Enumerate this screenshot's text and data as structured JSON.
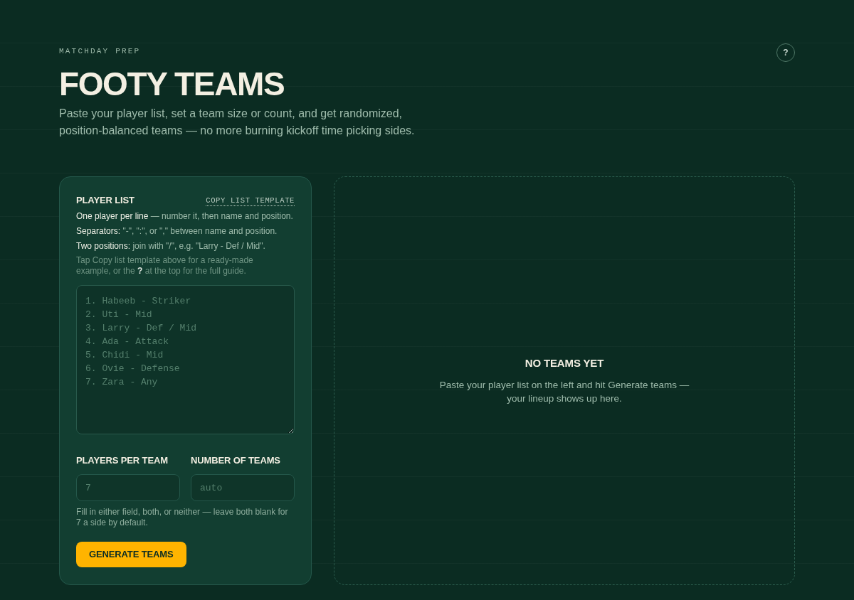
{
  "header": {
    "eyebrow": "MATCHDAY PREP",
    "title": "FOOTY TEAMS",
    "subtitle": "Paste your player list, set a team size or count, and get randomized, position-balanced teams — no more burning kickoff time picking sides.",
    "help_button": "?"
  },
  "player_list": {
    "heading": "PLAYER LIST",
    "copy_link": "COPY LIST TEMPLATE",
    "rules": [
      "**One player per line** — number it, then name and position.",
      "**Separators:** \"-\", \":\", or \",\" between name and position.",
      "**Two positions:** join with \"/\", e.g. \"Larry - Def / Mid\"."
    ],
    "tip": "Tap Copy list template above for a ready-made example, or the **?** at the top for the full guide.",
    "textarea": {
      "placeholder": "1. Habeeb - Striker\n2. Uti - Mid\n3. Larry - Def / Mid\n4. Ada - Attack\n5. Chidi - Mid\n6. Ovie - Defense\n7. Zara - Any"
    }
  },
  "team_settings": {
    "fields": [
      {
        "label": "PLAYERS PER TEAM",
        "placeholder": "7"
      },
      {
        "label": "NUMBER OF TEAMS",
        "placeholder": "auto"
      }
    ],
    "hint": "Fill in either field, both, or neither — leave both blank for 7 a side by default.",
    "button": "GENERATE TEAMS"
  },
  "results": {
    "title": "NO TEAMS YET",
    "message": "Paste your player list on the left and hit Generate teams — your lineup shows up here."
  }
}
